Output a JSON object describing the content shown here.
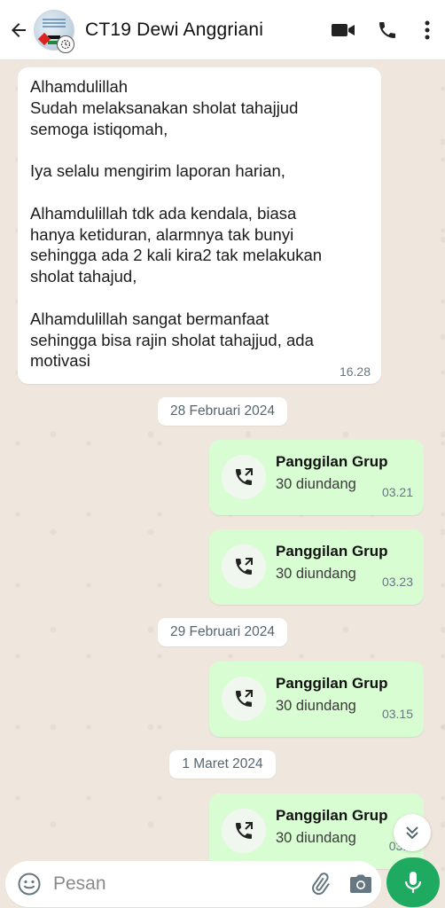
{
  "header": {
    "contact_name": "CT19 Dewi Anggriani",
    "icons": [
      "back-arrow-icon",
      "video-call-icon",
      "voice-call-icon",
      "more-vertical-icon"
    ]
  },
  "messages": {
    "incoming_text": "Alhamdulillah\nSudah melaksanakan sholat tahajjud\nsemoga istiqomah,\n\nIya selalu mengirim laporan harian,\n\nAlhamdulillah tdk ada kendala, biasa\nhanya ketiduran, alarmnya tak bunyi\nsehingga ada 2 kali kira2 tak melakukan\nsholat tahajud,\n\nAlhamdulillah sangat bermanfaat\nsehingga bisa rajin sholat tahajjud, ada\nmotivasi",
    "incoming_time": "16.28",
    "date_1": "28 Februari 2024",
    "date_2": "29 Februari 2024",
    "date_3": "1 Maret 2024",
    "calls": [
      {
        "title": "Panggilan Grup",
        "subtitle": "30 diundang",
        "time": "03.21"
      },
      {
        "title": "Panggilan Grup",
        "subtitle": "30 diundang",
        "time": "03.23"
      },
      {
        "title": "Panggilan Grup",
        "subtitle": "30 diundang",
        "time": "03.15"
      },
      {
        "title": "Panggilan Grup",
        "subtitle": "30 diundang",
        "time": "03.0"
      }
    ]
  },
  "composer": {
    "placeholder": "Pesan",
    "value": ""
  },
  "colors": {
    "outgoing_bubble": "#d9fdd3",
    "incoming_bubble": "#ffffff",
    "accent_green": "#1faa61",
    "chat_background": "#efe7de"
  }
}
